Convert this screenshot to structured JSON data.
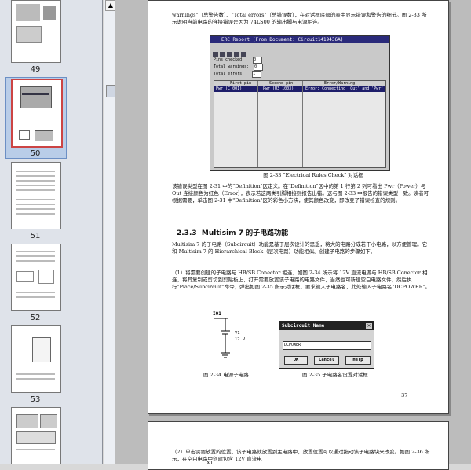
{
  "sidebar": {
    "thumbnails": [
      {
        "label": "49"
      },
      {
        "label": "50"
      },
      {
        "label": "51"
      },
      {
        "label": "52"
      },
      {
        "label": "53"
      }
    ]
  },
  "page": {
    "para1": "warnings\"（总警告数）、\"Total errors\"（总错误数），在对话框底部的表中显示错误和警告的细节。图 2-33 所示说明当前电路的连接错误是因为 74LS00 的输出脚与电源相连。",
    "erc_window": {
      "title": "ERC Report (From Document: Circuit1419436A)",
      "fields_checked_label": "Pins checked:",
      "fields_checked": "0",
      "total_warnings_label": "Total warnings:",
      "total_warnings": "0",
      "total_errors_label": "Total errors:",
      "total_errors": "1",
      "columns": [
        "First pin",
        "Second pin",
        "Error/Warning"
      ],
      "row": [
        "Pwr (C 001)",
        "Pwr (U3 1003)",
        "Error: Connecting 'Out' and 'Pwr' for"
      ]
    },
    "fig_2_33_caption": "图 2-33 \"Electrical Rules Check\" 对话框",
    "para2": "该错误类型在图 2-31 中的\"Definition\"区定义。在\"Definition\"区中的第 1 行第 2 列可看出 Pwr（Power）与 Out 连接颜色为红色（Error），表示若这两类引脚相接则报告出错。这与图 2-33 中报告的错误类型一致。读者可根据需要，单击图 2-31 中\"Definition\"区的彩色小方块，使其颜色改变，即改变了错误检查的规则。",
    "section_number": "2.3.3",
    "section_title": "Multisim 7 的子电路功能",
    "para3": "Multisim 7 的子电路（Subcircuit）功能是基于层次设计的思想，将大的电路分成若干小电路，以方便管理。它和 Multisim 7 的 Hierarchical Block（层次电路）功能相似。创建子电路的步骤如下。",
    "para4": "（1）将需要创建的子电路与 HB/SB Conector 相连，如图 2-34 所示将 12V 直流电源与 HB/SB Conector 相连，将其复制或剪切到剪贴板上，打开需要放置该子电路的电路文件，当然也可新建空白电路文件，然后执行\"Place/Subcircuit\"命令，弹出如图 2-35 所示对话框，要求输入子电路名，此处输入子电路名\"DCPOWER\"。",
    "circuit": {
      "io_label": "IO1",
      "source_label": "V1",
      "voltage_label": "12 V"
    },
    "fig_2_34_caption": "图 2-34   电源子电路",
    "dialog": {
      "title": "Subcircuit Name",
      "input_value": "DCPOWER",
      "ok": "OK",
      "cancel": "Cancel",
      "help": "Help"
    },
    "fig_2_35_caption": "图 2-35   子电路名设置对话框",
    "page_number": "· 37 ·",
    "page2_text": "（2）单击需要放置的位置，该子电路就放置到主电路中，放置位置可以通过拖动该子电路块来改变。如图 2-36 所示，在空白电路中创建包含 12V 直流电",
    "page2_label": "X1"
  }
}
